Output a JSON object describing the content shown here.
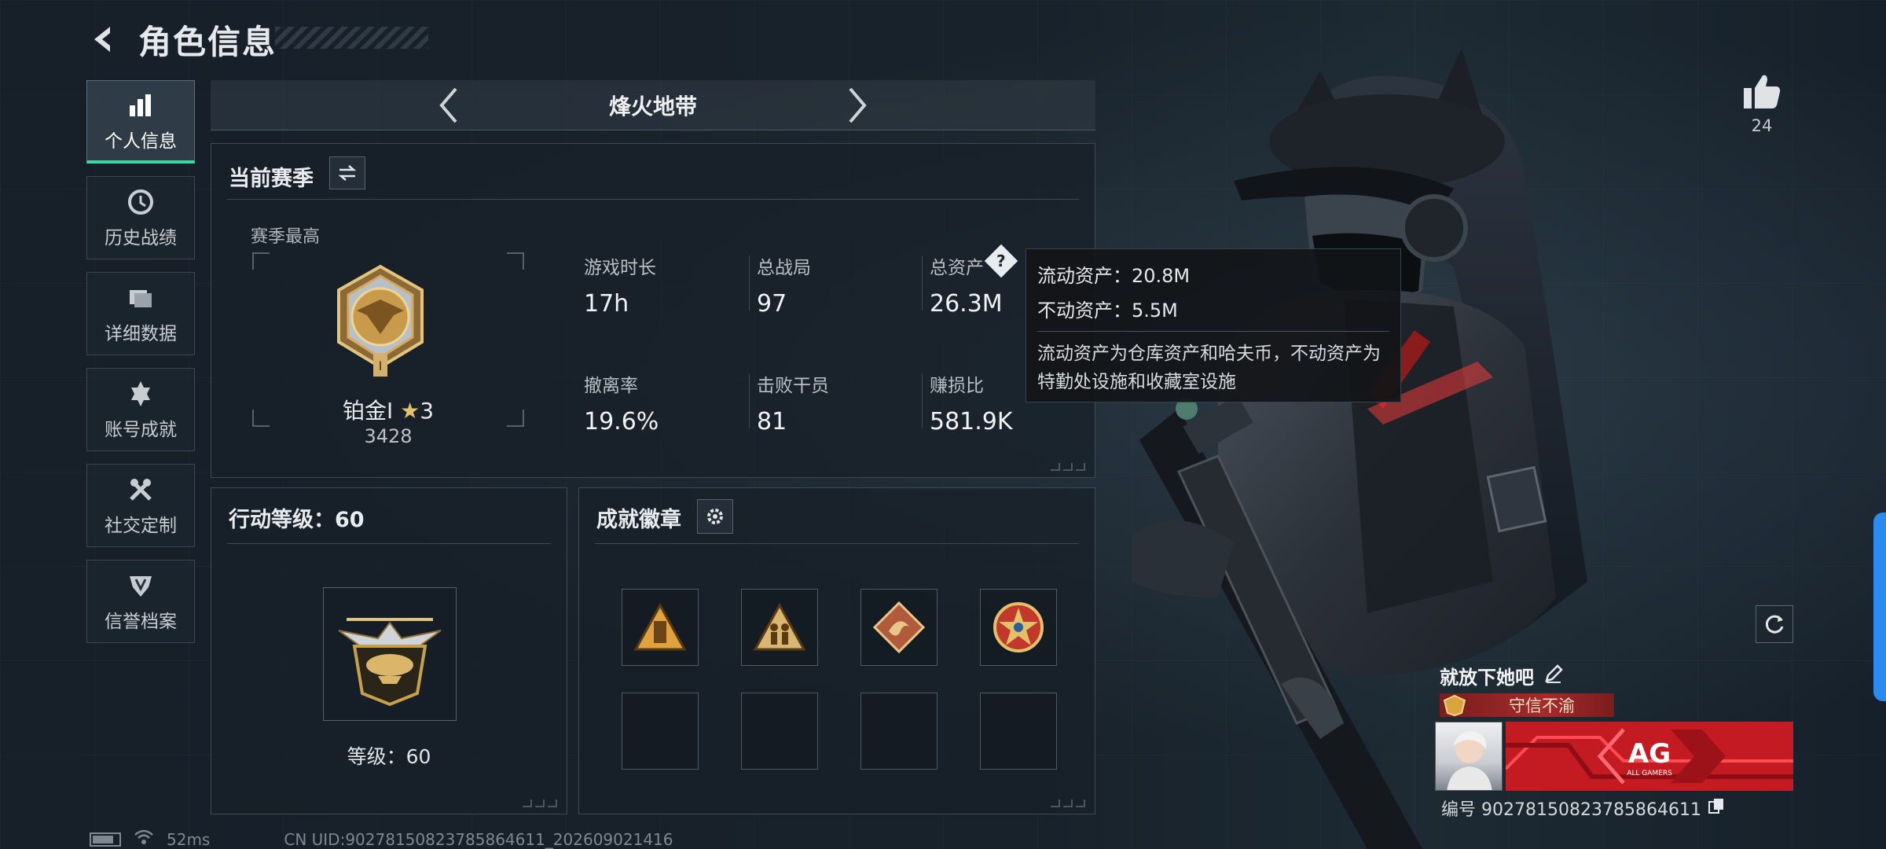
{
  "header": {
    "title": "角色信息"
  },
  "sidebar": {
    "items": [
      {
        "label": "个人信息",
        "icon": "bar-chart-icon",
        "active": true
      },
      {
        "label": "历史战绩",
        "icon": "clock-history-icon"
      },
      {
        "label": "详细数据",
        "icon": "folder-icon"
      },
      {
        "label": "账号成就",
        "icon": "achievement-cross-icon"
      },
      {
        "label": "社交定制",
        "icon": "tools-icon"
      },
      {
        "label": "信誉档案",
        "icon": "reputation-shield-icon"
      }
    ]
  },
  "mode": {
    "title": "烽火地带"
  },
  "season": {
    "title": "当前赛季",
    "best_label": "赛季最高",
    "rank": {
      "name": "铂金Ⅰ",
      "stars": "3",
      "score": "3428"
    },
    "stats": [
      {
        "label": "游戏时长",
        "value": "17h"
      },
      {
        "label": "总战局",
        "value": "97"
      },
      {
        "label": "总资产",
        "value": "26.3M"
      },
      {
        "label": "撤离率",
        "value": "19.6%"
      },
      {
        "label": "击败干员",
        "value": "81"
      },
      {
        "label": "赚损比",
        "value": "581.9K"
      }
    ]
  },
  "tooltip": {
    "liquid": "流动资产：20.8M",
    "fixed": "不动资产：5.5M",
    "description": "流动资产为仓库资产和哈夫币，不动资产为特勤处设施和收藏室设施"
  },
  "level": {
    "title": "行动等级：60",
    "text": "等级：60"
  },
  "achievements": {
    "title": "成就徽章",
    "slots_filled": 4,
    "slots_total": 8
  },
  "profile": {
    "likes": "24",
    "name": "就放下她吧",
    "honor_title": "守信不渝",
    "id": "编号 90278150823785864611",
    "banner_text": "AG",
    "banner_subtext": "ALL GAMERS"
  },
  "footer": {
    "ping": "52ms",
    "uid": "CN UID:90278150823785864611_202609021416"
  },
  "colors": {
    "accent": "#3fd6a4",
    "gold": "#c9a04a",
    "banner_red": "#c41a22",
    "edge_tab": "#2a8cf0"
  }
}
